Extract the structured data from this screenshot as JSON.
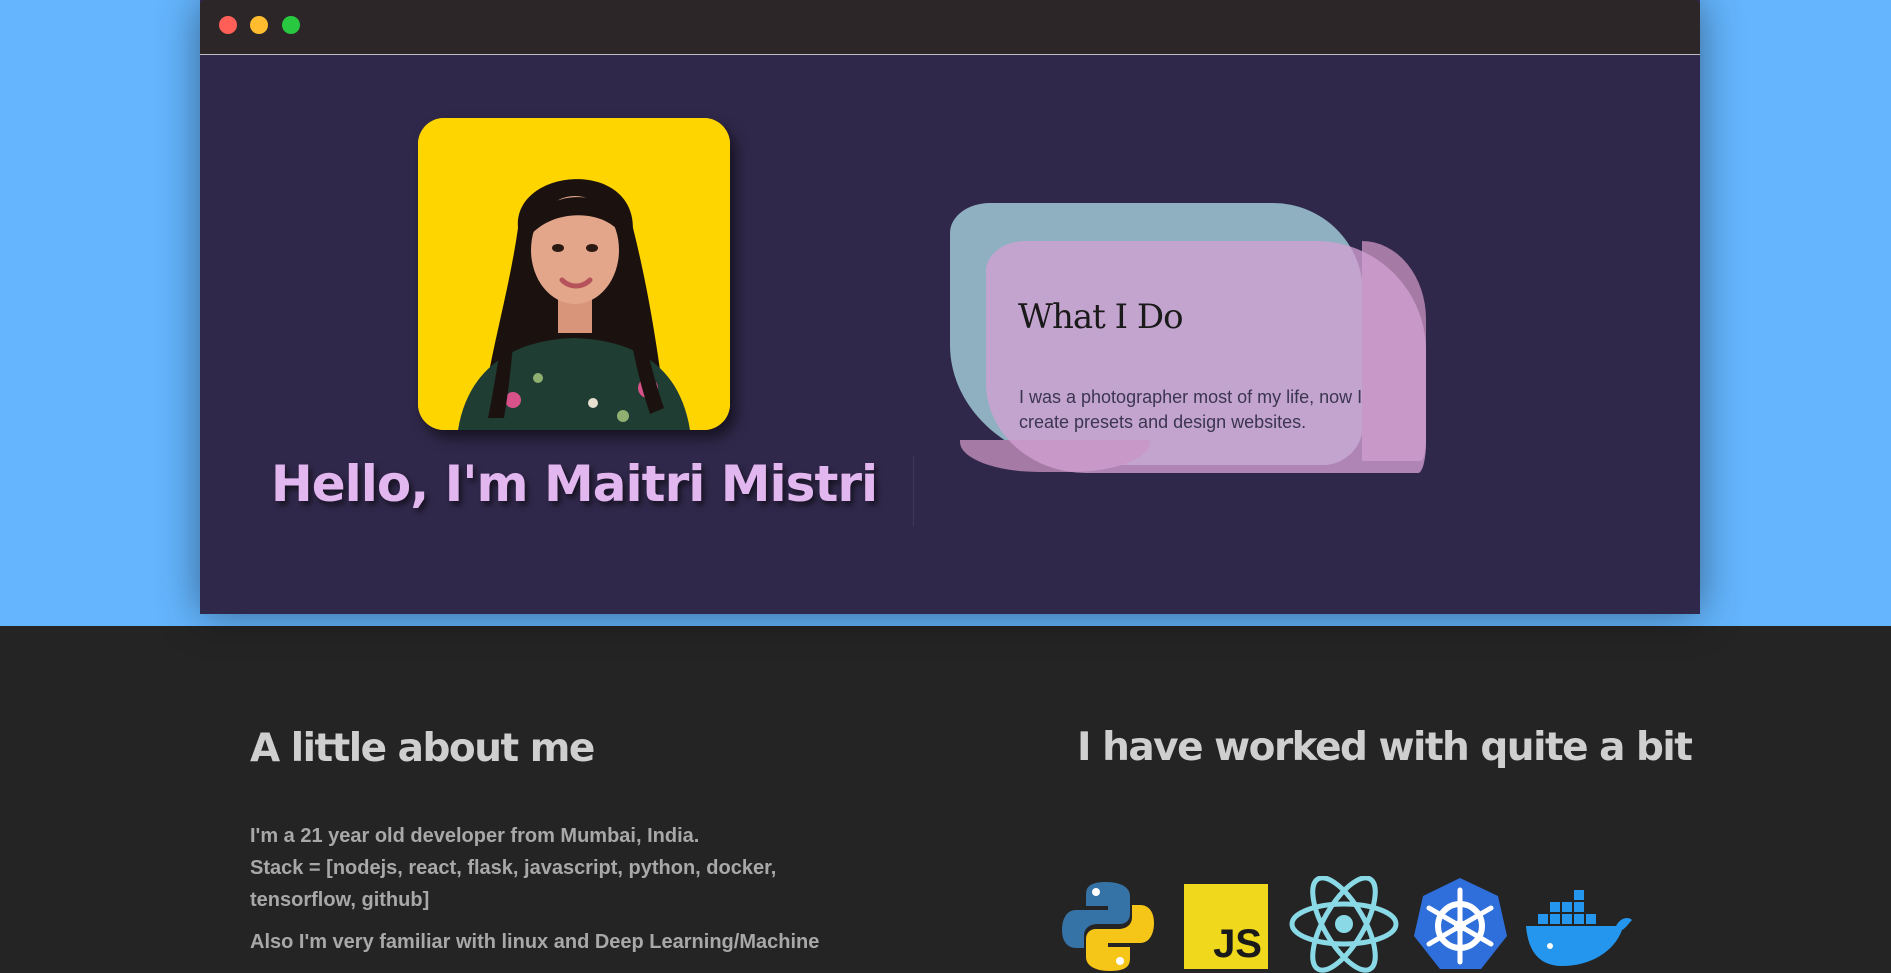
{
  "hero": {
    "greeting": "Hello, I'm Maitri Mistri"
  },
  "what_i_do": {
    "title": "What I Do",
    "body": "I was a photographer most of my life, now I create presets and design websites."
  },
  "about": {
    "title": "A little about me",
    "line1": "I'm a 21 year old developer from Mumbai, India.",
    "line2": "Stack = [nodejs, react, flask, javascript, python, docker, tensorflow, github]",
    "line3": "Also I'm very familiar with linux and Deep Learning/Machine"
  },
  "stack": {
    "title": "I have worked with quite a bit",
    "js_logo_text": "JS",
    "icons": [
      "python-icon",
      "javascript-icon",
      "react-icon",
      "kubernetes-icon",
      "docker-icon"
    ]
  },
  "colors": {
    "hero_background": "#64b5fe",
    "window_background": "#30284a",
    "portrait_background": "#ffd500",
    "greeting": "#e2b6ee",
    "dark_section": "#242424"
  }
}
